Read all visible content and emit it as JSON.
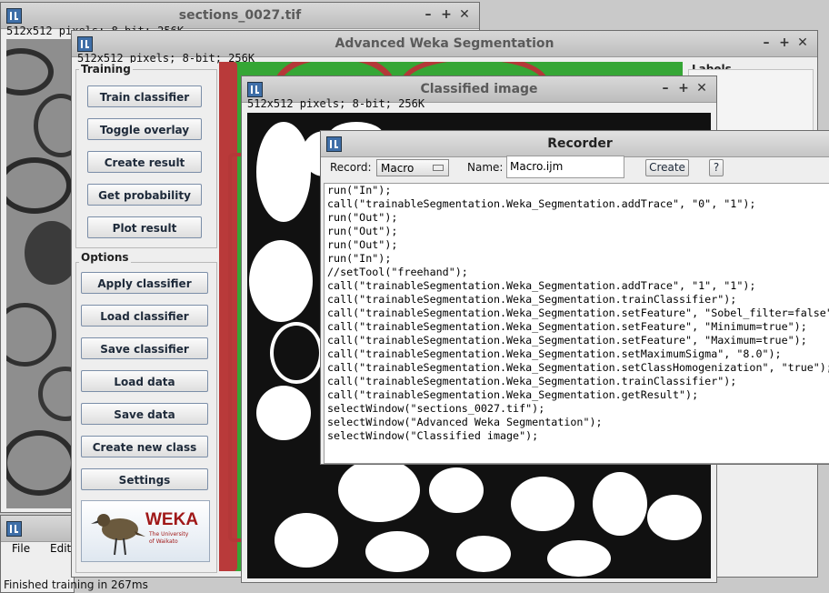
{
  "windows": {
    "sections": {
      "title": "sections_0027.tif",
      "info": "512x512 pixels; 8-bit; 256K"
    },
    "weka": {
      "title": "Advanced Weka Segmentation",
      "info": "512x512 pixels; 8-bit; 256K",
      "training_label": "Training",
      "options_label": "Options",
      "labels_label": "Labels",
      "training_buttons": [
        "Train classifier",
        "Toggle overlay",
        "Create result",
        "Get probability",
        "Plot result"
      ],
      "option_buttons": [
        "Apply classifier",
        "Load classifier",
        "Save classifier",
        "Load data",
        "Save data",
        "Create new class",
        "Settings"
      ],
      "logo": {
        "name": "WEKA",
        "sub1": "The University",
        "sub2": "of Waikato"
      }
    },
    "classified": {
      "title": "Classified image",
      "info": "512x512 pixels; 8-bit; 256K"
    },
    "recorder": {
      "title": "Recorder",
      "record_label": "Record:",
      "record_value": "Macro",
      "name_label": "Name:",
      "name_value": "Macro.ijm",
      "create_label": "Create",
      "help_label": "?",
      "code_lines": [
        "run(\"In\");",
        "call(\"trainableSegmentation.Weka_Segmentation.addTrace\", \"0\", \"1\");",
        "run(\"Out\");",
        "run(\"Out\");",
        "run(\"Out\");",
        "run(\"In\");",
        "//setTool(\"freehand\");",
        "call(\"trainableSegmentation.Weka_Segmentation.addTrace\", \"1\", \"1\");",
        "call(\"trainableSegmentation.Weka_Segmentation.trainClassifier\");",
        "call(\"trainableSegmentation.Weka_Segmentation.setFeature\", \"Sobel_filter=false\");",
        "call(\"trainableSegmentation.Weka_Segmentation.setFeature\", \"Minimum=true\");",
        "call(\"trainableSegmentation.Weka_Segmentation.setFeature\", \"Maximum=true\");",
        "call(\"trainableSegmentation.Weka_Segmentation.setMaximumSigma\", \"8.0\");",
        "call(\"trainableSegmentation.Weka_Segmentation.setClassHomogenization\", \"true\");",
        "call(\"trainableSegmentation.Weka_Segmentation.trainClassifier\");",
        "call(\"trainableSegmentation.Weka_Segmentation.getResult\");",
        "selectWindow(\"sections_0027.tif\");",
        "selectWindow(\"Advanced Weka Segmentation\");",
        "selectWindow(\"Classified image\");"
      ]
    },
    "imagej": {
      "menu": [
        "File",
        "Edit"
      ],
      "status": "Finished training in 267ms"
    }
  },
  "window_controls": {
    "minimize": "–",
    "maximize": "+",
    "close": "✕"
  }
}
